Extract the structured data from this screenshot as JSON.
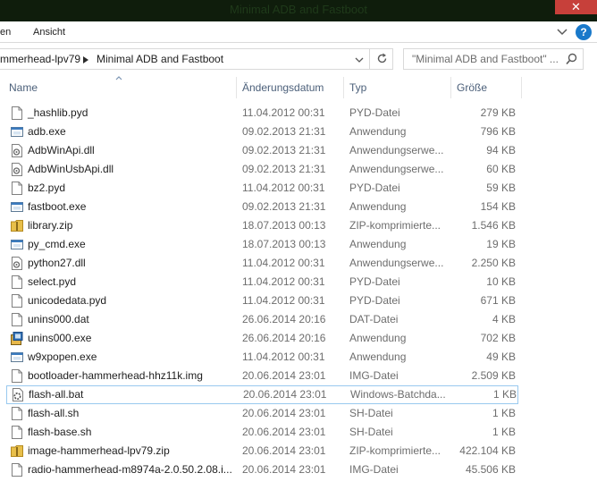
{
  "window": {
    "title": "Minimal ADB and Fastboot",
    "close_glyph": "✕"
  },
  "ribbon": {
    "tabs": [
      "en",
      "Ansicht"
    ],
    "help_glyph": "?"
  },
  "address": {
    "crumbs": [
      "mmerhead-lpv79",
      "Minimal ADB and Fastboot"
    ]
  },
  "search": {
    "placeholder": "\"Minimal ADB and Fastboot\" ..."
  },
  "columns": {
    "name": "Name",
    "date": "Änderungsdatum",
    "type": "Typ",
    "size": "Größe"
  },
  "files": [
    {
      "name": "_hashlib.pyd",
      "date": "11.04.2012 00:31",
      "type": "PYD-Datei",
      "size": "279 KB",
      "icon": "file-icon"
    },
    {
      "name": "adb.exe",
      "date": "09.02.2013 21:31",
      "type": "Anwendung",
      "size": "796 KB",
      "icon": "exe-icon"
    },
    {
      "name": "AdbWinApi.dll",
      "date": "09.02.2013 21:31",
      "type": "Anwendungserwe...",
      "size": "94 KB",
      "icon": "dll-icon"
    },
    {
      "name": "AdbWinUsbApi.dll",
      "date": "09.02.2013 21:31",
      "type": "Anwendungserwe...",
      "size": "60 KB",
      "icon": "dll-icon"
    },
    {
      "name": "bz2.pyd",
      "date": "11.04.2012 00:31",
      "type": "PYD-Datei",
      "size": "59 KB",
      "icon": "file-icon"
    },
    {
      "name": "fastboot.exe",
      "date": "09.02.2013 21:31",
      "type": "Anwendung",
      "size": "154 KB",
      "icon": "exe-icon"
    },
    {
      "name": "library.zip",
      "date": "18.07.2013 00:13",
      "type": "ZIP-komprimierte...",
      "size": "1.546 KB",
      "icon": "zip-icon"
    },
    {
      "name": "py_cmd.exe",
      "date": "18.07.2013 00:13",
      "type": "Anwendung",
      "size": "19 KB",
      "icon": "exe-icon"
    },
    {
      "name": "python27.dll",
      "date": "11.04.2012 00:31",
      "type": "Anwendungserwe...",
      "size": "2.250 KB",
      "icon": "dll-icon"
    },
    {
      "name": "select.pyd",
      "date": "11.04.2012 00:31",
      "type": "PYD-Datei",
      "size": "10 KB",
      "icon": "file-icon"
    },
    {
      "name": "unicodedata.pyd",
      "date": "11.04.2012 00:31",
      "type": "PYD-Datei",
      "size": "671 KB",
      "icon": "file-icon"
    },
    {
      "name": "unins000.dat",
      "date": "26.06.2014 20:16",
      "type": "DAT-Datei",
      "size": "4 KB",
      "icon": "file-icon"
    },
    {
      "name": "unins000.exe",
      "date": "26.06.2014 20:16",
      "type": "Anwendung",
      "size": "702 KB",
      "icon": "installer-icon"
    },
    {
      "name": "w9xpopen.exe",
      "date": "11.04.2012 00:31",
      "type": "Anwendung",
      "size": "49 KB",
      "icon": "exe-icon"
    },
    {
      "name": "bootloader-hammerhead-hhz11k.img",
      "date": "20.06.2014 23:01",
      "type": "IMG-Datei",
      "size": "2.509 KB",
      "icon": "file-icon"
    },
    {
      "name": "flash-all.bat",
      "date": "20.06.2014 23:01",
      "type": "Windows-Batchda...",
      "size": "1 KB",
      "icon": "batch-icon",
      "selected": true
    },
    {
      "name": "flash-all.sh",
      "date": "20.06.2014 23:01",
      "type": "SH-Datei",
      "size": "1 KB",
      "icon": "file-icon"
    },
    {
      "name": "flash-base.sh",
      "date": "20.06.2014 23:01",
      "type": "SH-Datei",
      "size": "1 KB",
      "icon": "file-icon"
    },
    {
      "name": "image-hammerhead-lpv79.zip",
      "date": "20.06.2014 23:01",
      "type": "ZIP-komprimierte...",
      "size": "422.104 KB",
      "icon": "zip-icon"
    },
    {
      "name": "radio-hammerhead-m8974a-2.0.50.2.08.i...",
      "date": "20.06.2014 23:01",
      "type": "IMG-Datei",
      "size": "45.506 KB",
      "icon": "file-icon"
    }
  ]
}
